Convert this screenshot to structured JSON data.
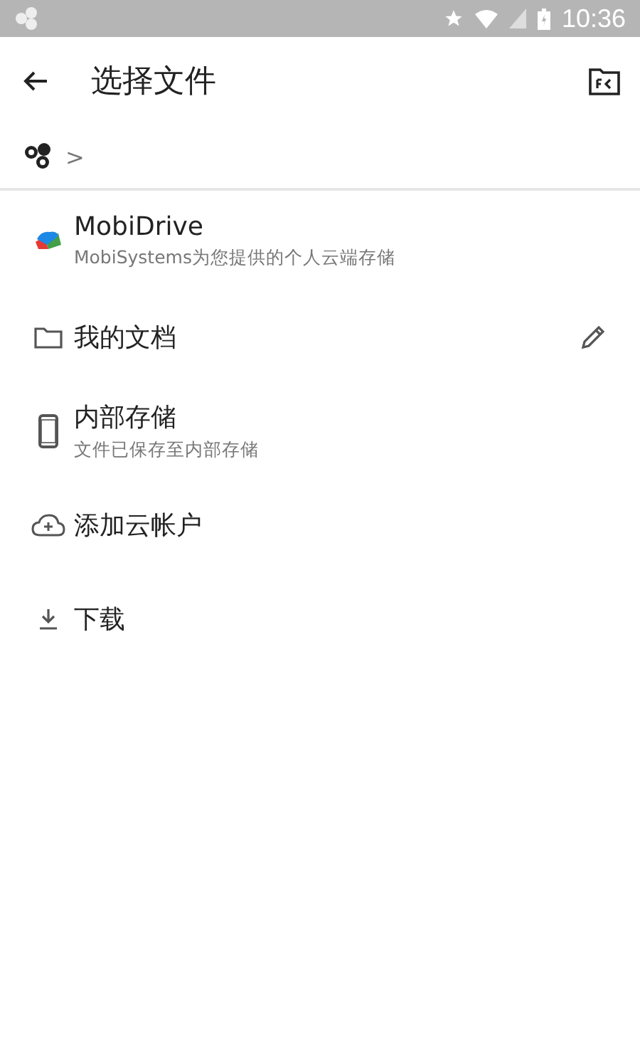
{
  "status_bar": {
    "time": "10:36"
  },
  "toolbar": {
    "title": "选择文件"
  },
  "breadcrumb": {
    "separator": ">"
  },
  "items": [
    {
      "kind": "drive",
      "title": "MobiDrive",
      "subtitle": "MobiSystems为您提供的个人云端存储",
      "editable": false
    },
    {
      "kind": "folder",
      "title": "我的文档",
      "editable": true
    },
    {
      "kind": "phone",
      "title": "内部存储",
      "subtitle": "文件已保存至内部存储",
      "editable": false
    },
    {
      "kind": "cloud",
      "title": "添加云帐户",
      "editable": false
    },
    {
      "kind": "download",
      "title": "下载",
      "editable": false
    }
  ]
}
